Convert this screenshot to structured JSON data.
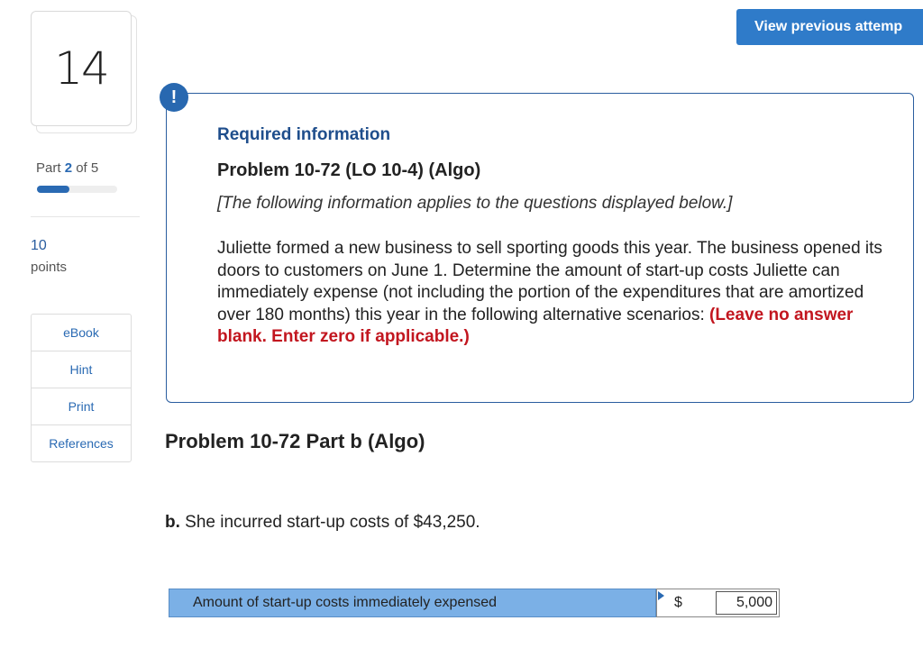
{
  "question_number": "14",
  "part": {
    "prefix": "Part",
    "current": "2",
    "suffix": "of 5",
    "progress_fraction": 0.4
  },
  "points": {
    "value": "10",
    "label": "points"
  },
  "tools": [
    {
      "label": "eBook"
    },
    {
      "label": "Hint"
    },
    {
      "label": "Print"
    },
    {
      "label": "References"
    }
  ],
  "view_previous_label": "View previous attemp",
  "alert_glyph": "!",
  "info": {
    "required_title": "Required information",
    "problem_title": "Problem 10-72 (LO 10-4) (Algo)",
    "applies_note": "[The following information applies to the questions displayed below.]",
    "body": "Juliette formed a new business to sell sporting goods this year. The business opened its doors to customers on June 1. Determine the amount of start-up costs Juliette can immediately expense (not including the portion of the expenditures that are amortized over 180 months) this year in the following alternative scenarios: ",
    "instruction": "(Leave no answer blank. Enter zero if applicable.)"
  },
  "part_heading": "Problem 10-72 Part b (Algo)",
  "question": {
    "label": "b.",
    "text": " She incurred start-up costs of $43,250."
  },
  "answer": {
    "label": "Amount of start-up costs immediately expensed",
    "currency": "$",
    "value": "5,000"
  },
  "colors": {
    "accent": "#2a6ab3",
    "button": "#2f7bc9",
    "warning_text": "#c2161f",
    "answer_label_bg": "#7bb0e6"
  }
}
